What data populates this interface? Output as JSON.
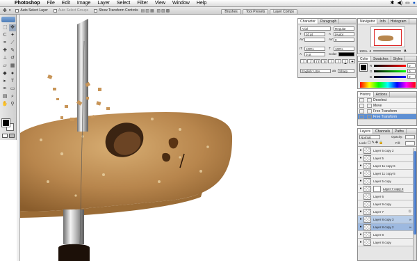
{
  "menubar": {
    "apple_glyph": "",
    "app_name": "Photoshop",
    "items": [
      "File",
      "Edit",
      "Image",
      "Layer",
      "Select",
      "Filter",
      "View",
      "Window",
      "Help"
    ]
  },
  "options_bar": {
    "auto_select": "Auto Select Layer",
    "auto_select_groups": "Auto Select Groups",
    "show_transform": "Show Transform Controls",
    "tabs": [
      "Brushes",
      "Tool Presets",
      "Layer Comps"
    ]
  },
  "character_panel": {
    "tabs": [
      "Character",
      "Paragraph"
    ],
    "font_family": "Arial",
    "font_style": "Regular",
    "size": "10 pt",
    "leading": "(Auto)",
    "kerning": "0",
    "tracking": "100%",
    "vertical_scale": "100%",
    "horizontal_scale": "100%",
    "baseline": "0 pt",
    "color_label": "Color:",
    "language": "English: USA",
    "antialias": "Sharp",
    "style_buttons": [
      "T",
      "T",
      "TT",
      "Tr",
      "T",
      "T",
      "T",
      "T"
    ]
  },
  "navigator_panel": {
    "tabs": [
      "Navigator",
      "Info",
      "Histogram"
    ],
    "zoom": "100%"
  },
  "color_panel": {
    "tabs": [
      "Color",
      "Swatches",
      "Styles"
    ],
    "channels": [
      "R",
      "G",
      "B"
    ],
    "values": [
      "0",
      "0",
      "0"
    ]
  },
  "history_panel": {
    "tabs": [
      "History",
      "Actions"
    ],
    "items": [
      {
        "label": "Deselect",
        "active": false
      },
      {
        "label": "Move",
        "active": false
      },
      {
        "label": "Free Transform",
        "active": false
      },
      {
        "label": "Free Transform",
        "active": true
      }
    ]
  },
  "layers_panel": {
    "tabs": [
      "Layers",
      "Channels",
      "Paths"
    ],
    "blend_mode": "Normal",
    "opacity_label": "Opacity:",
    "lock_label": "Lock:",
    "fill_label": "Fill:",
    "layers": [
      {
        "name": "Layer 5 copy 2",
        "state": "normal"
      },
      {
        "name": "Layer 5",
        "state": "normal"
      },
      {
        "name": "Layer 11 copy 6",
        "state": "normal"
      },
      {
        "name": "Layer 11 copy 5",
        "state": "normal"
      },
      {
        "name": "Layer 5 copy",
        "state": "normal"
      },
      {
        "name": "Layer 7 copy 2",
        "state": "normal"
      },
      {
        "name": "Layer 6",
        "state": "normal"
      },
      {
        "name": "Layer 9 copy",
        "state": "normal"
      },
      {
        "name": "Layer 7",
        "state": "normal"
      },
      {
        "name": "Layer 8 copy 3",
        "state": "selected"
      },
      {
        "name": "Layer 8 copy 2",
        "state": "active"
      },
      {
        "name": "Layer 8",
        "state": "normal"
      },
      {
        "name": "Layer 8 copy",
        "state": "normal"
      }
    ]
  },
  "colors": {
    "foreground": "#000000",
    "background": "#ffffff",
    "selection": "#5d8fd3"
  }
}
